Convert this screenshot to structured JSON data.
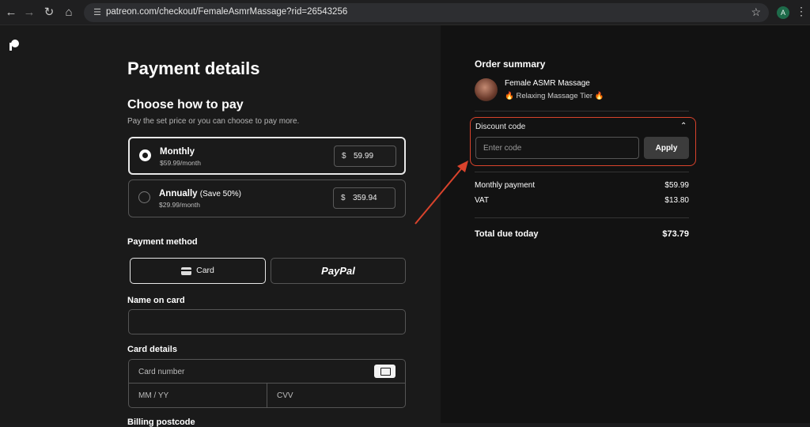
{
  "browser": {
    "url": "patreon.com/checkout/FemaleAsmrMassage?rid=26543256",
    "profile_initial": "A"
  },
  "checkout": {
    "title": "Payment details",
    "choose_title": "Choose how to pay",
    "choose_desc": "Pay the set price or you can choose to pay more.",
    "plans": [
      {
        "name": "Monthly",
        "note": "",
        "sub": "$59.99/month",
        "currency": "$",
        "amount": "59.99",
        "selected": true
      },
      {
        "name": "Annually",
        "note": "(Save 50%)",
        "sub": "$29.99/month",
        "currency": "$",
        "amount": "359.94",
        "selected": false
      }
    ],
    "payment_method_label": "Payment method",
    "card_label": "Card",
    "paypal_label": "PayPal",
    "name_on_card_label": "Name on card",
    "card_details_label": "Card details",
    "card_number_placeholder": "Card number",
    "expiry_placeholder": "MM / YY",
    "cvv_placeholder": "CVV",
    "billing_label": "Billing postcode"
  },
  "order": {
    "title": "Order summary",
    "creator": "Female ASMR Massage",
    "tier": "🔥 Relaxing Massage Tier 🔥",
    "discount_label": "Discount code",
    "discount_placeholder": "Enter code",
    "apply_label": "Apply",
    "rows": [
      {
        "label": "Monthly payment",
        "value": "$59.99"
      },
      {
        "label": "VAT",
        "value": "$13.80"
      }
    ],
    "total_label": "Total due today",
    "total_value": "$73.79"
  },
  "colors": {
    "highlight": "#d9432c",
    "left_bg": "#1a1a1a",
    "right_bg": "#121212"
  }
}
